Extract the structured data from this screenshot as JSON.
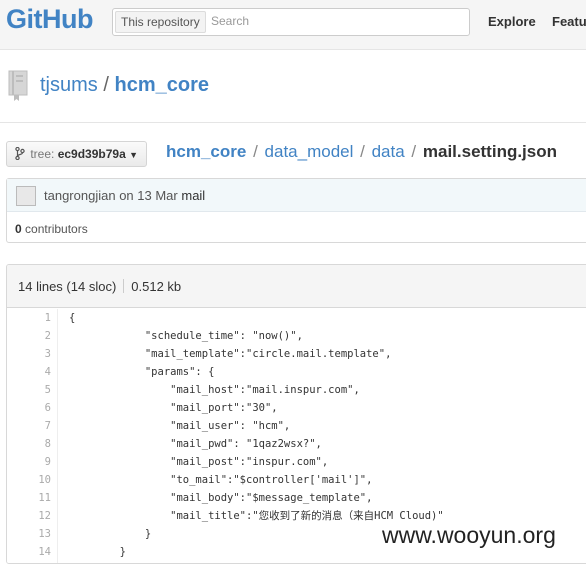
{
  "header": {
    "logo": "GitHub",
    "search_scope": "This repository",
    "search_placeholder": "Search",
    "nav": [
      "Explore",
      "Featu"
    ]
  },
  "repo": {
    "owner": "tjsums",
    "separator": "/",
    "name": "hcm_core"
  },
  "branch": {
    "label": "tree:",
    "value": "ec9d39b79a"
  },
  "breadcrumb": {
    "segments": [
      "hcm_core",
      "data_model",
      "data"
    ],
    "separator": "/",
    "file": "mail.setting.json"
  },
  "commit": {
    "author": "tangrongjian",
    "date_text": "on 13 Mar",
    "message": "mail",
    "contributors_count": "0",
    "contributors_label": "contributors"
  },
  "file": {
    "lines_info": "14 lines (14 sloc)",
    "size": "0.512 kb",
    "line_numbers": [
      "1",
      "2",
      "3",
      "4",
      "5",
      "6",
      "7",
      "8",
      "9",
      "10",
      "11",
      "12",
      "13",
      "14"
    ],
    "lines": [
      "{",
      "            \"schedule_time\": \"now()\",",
      "            \"mail_template\":\"circle.mail.template\",",
      "            \"params\": {",
      "                \"mail_host\":\"mail.inspur.com\",",
      "                \"mail_port\":\"30\",",
      "                \"mail_user\": \"hcm\",",
      "                \"mail_pwd\": \"1qaz2wsx?\",",
      "                \"mail_post\":\"inspur.com\",",
      "                \"to_mail\":\"$controller['mail']\",",
      "                \"mail_body\":\"$message_template\",",
      "                \"mail_title\":\"您收到了新的消息（来自HCM Cloud)\"",
      "            }",
      "        }"
    ]
  },
  "watermark": "www.wooyun.org"
}
